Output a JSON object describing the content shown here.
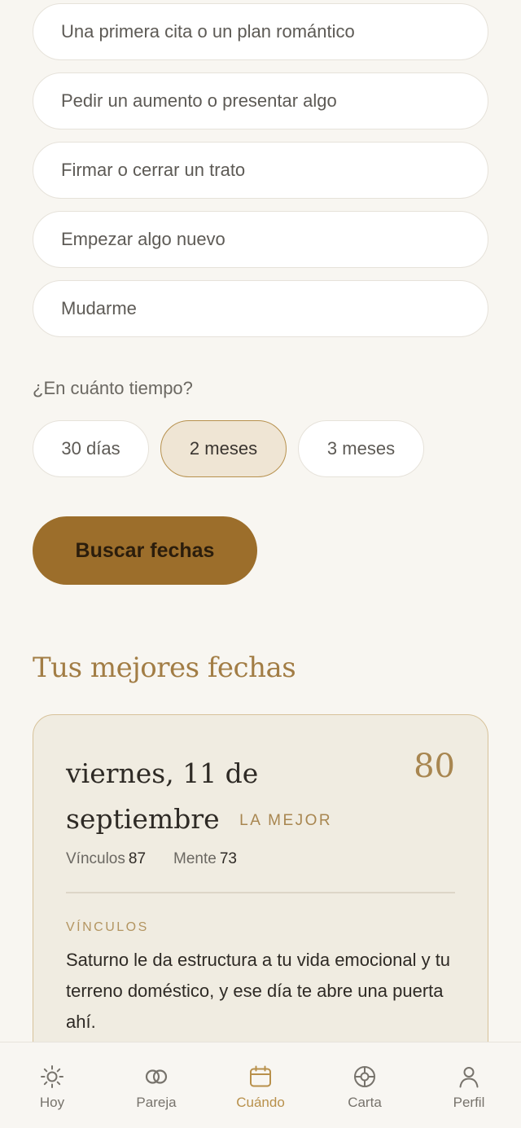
{
  "options": [
    "Una primera cita o un plan romántico",
    "Pedir un aumento o presentar algo",
    "Firmar o cerrar un trato",
    "Empezar algo nuevo",
    "Mudarme"
  ],
  "timeframe": {
    "question": "¿En cuánto tiempo?",
    "chips": [
      "30 días",
      "2 meses",
      "3 meses"
    ],
    "selected": "2 meses"
  },
  "search_button": "Buscar fechas",
  "results": {
    "title": "Tus mejores fechas",
    "card": {
      "date": "viernes, 11 de septiembre",
      "badge": "LA MEJOR",
      "score": "80",
      "metrics": [
        {
          "label": "Vínculos",
          "value": "87"
        },
        {
          "label": "Mente",
          "value": "73"
        }
      ],
      "category": "VÍNCULOS",
      "text": "Saturno le da estructura a tu vida emocional y tu terreno doméstico, y ese día te abre una puerta ahí."
    }
  },
  "nav": {
    "items": [
      {
        "label": "Hoy",
        "icon": "sun-icon"
      },
      {
        "label": "Pareja",
        "icon": "rings-icon"
      },
      {
        "label": "Cuándo",
        "icon": "calendar-icon"
      },
      {
        "label": "Carta",
        "icon": "chart-wheel-icon"
      },
      {
        "label": "Perfil",
        "icon": "user-icon"
      }
    ],
    "active": "Cuándo"
  },
  "colors": {
    "background": "#f8f6f1",
    "accent": "#9c6e2b",
    "gold_text": "#a88650",
    "card_bg": "#f0ece1"
  }
}
